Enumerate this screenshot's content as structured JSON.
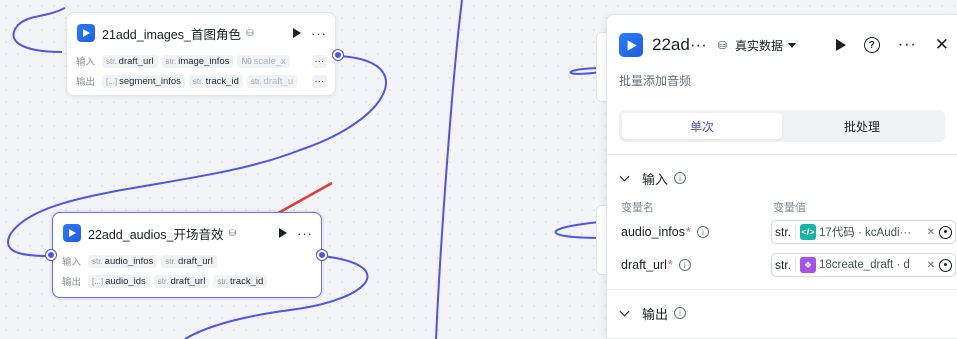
{
  "colors": {
    "accent": "#4e55e8",
    "node_icon": "#2a7bff",
    "arrow": "#e53935",
    "code_src": "#16b3a7",
    "box_src": "#a552e8"
  },
  "node_images": {
    "title": "21add_images_首图角色",
    "input_label": "输入",
    "output_label": "输出",
    "inputs": [
      {
        "type": "str.",
        "name": "draft_url"
      },
      {
        "type": "str.",
        "name": "image_infos"
      },
      {
        "type": "N0",
        "name": "scale_x"
      }
    ],
    "outputs": [
      {
        "type": "[...]",
        "name": "segment_infos"
      },
      {
        "type": "str.",
        "name": "track_id"
      },
      {
        "type": "str.",
        "name": "draft_u"
      }
    ],
    "more_tag": "···"
  },
  "node_audios": {
    "title": "22add_audios_开场音效",
    "input_label": "输入",
    "output_label": "输出",
    "inputs": [
      {
        "type": "str.",
        "name": "audio_infos"
      },
      {
        "type": "str.",
        "name": "draft_url"
      }
    ],
    "outputs": [
      {
        "type": "[...]",
        "name": "audio_ids"
      },
      {
        "type": "str.",
        "name": "draft_url"
      },
      {
        "type": "str.",
        "name": "track_id"
      }
    ]
  },
  "panel": {
    "title": "22ad···",
    "mode": "真实数据",
    "description": "批量添加音频",
    "tabs": [
      "单次",
      "批处理"
    ],
    "active_tab": 0,
    "input_section": "输入",
    "col_name": "变量名",
    "col_value": "变量值",
    "variables": [
      {
        "name": "audio_infos",
        "type": "str.",
        "source_icon": "code-icon",
        "source_glyph": "</>",
        "value": "17代码 · kcAudi···"
      },
      {
        "name": "draft_url",
        "type": "str.",
        "source_icon": "box-icon",
        "source_glyph": "❖",
        "value": "18create_draft · d"
      }
    ],
    "output_section": "输出"
  }
}
